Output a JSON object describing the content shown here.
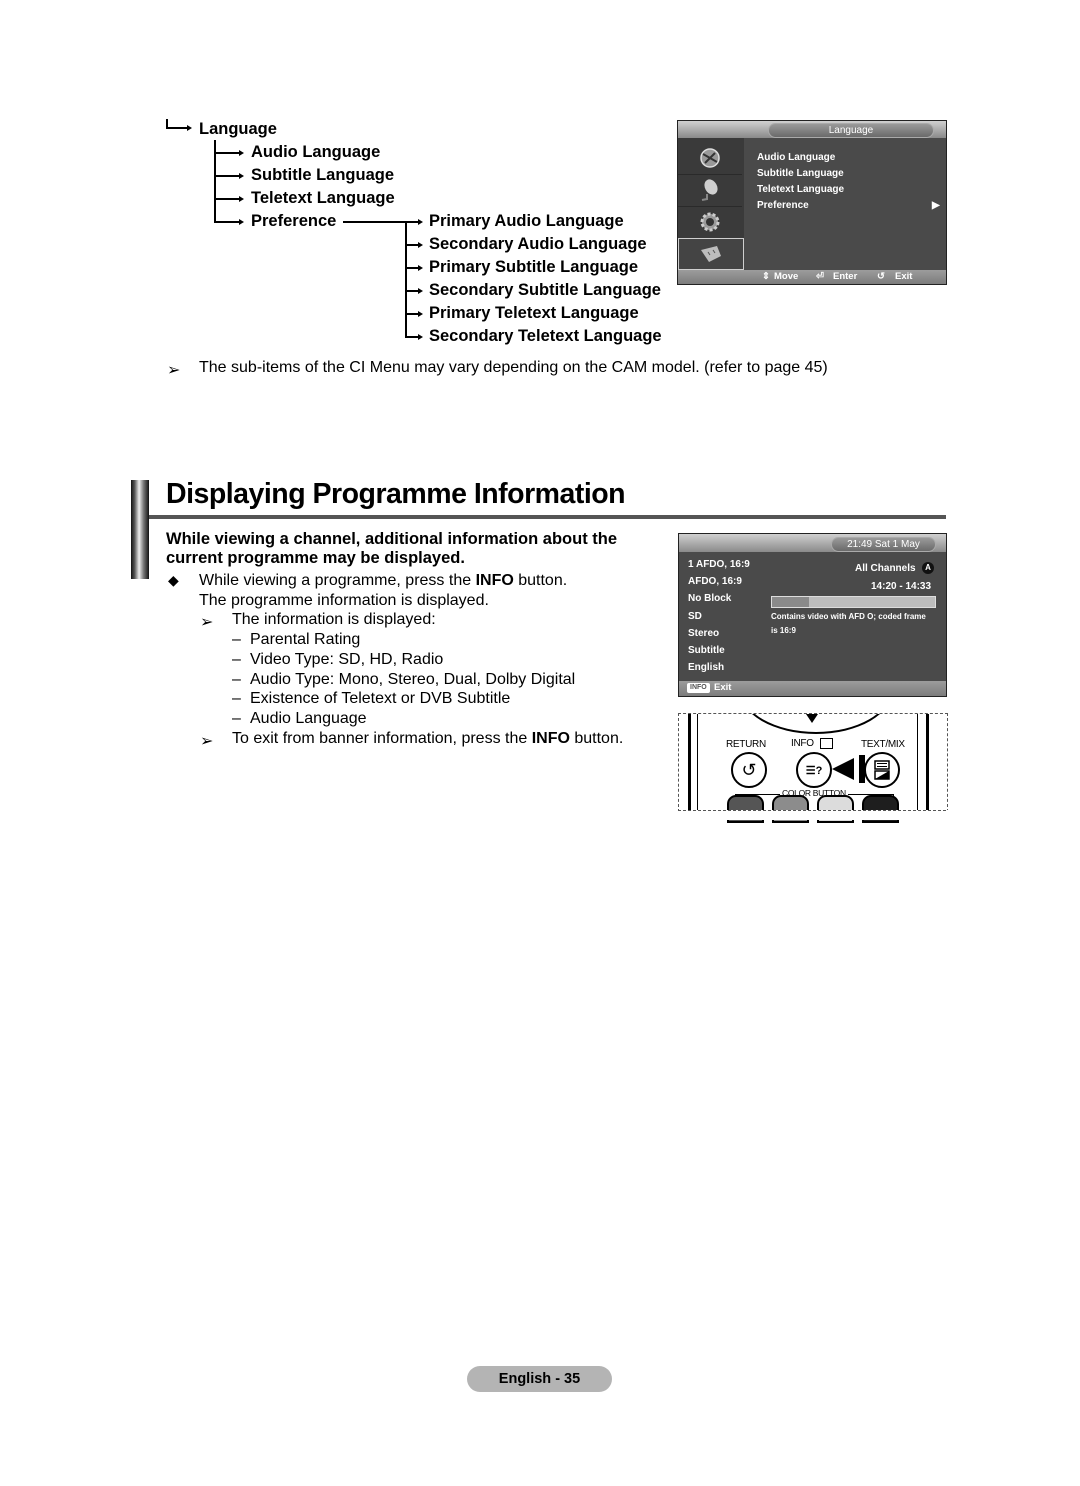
{
  "language_tree": {
    "root": "Language",
    "children": [
      "Audio Language",
      "Subtitle Language",
      "Teletext Language",
      "Preference"
    ],
    "preference_children": [
      "Primary Audio Language",
      "Secondary Audio Language",
      "Primary Subtitle Language",
      "Secondary Subtitle Language",
      "Primary Teletext Language",
      "Secondary Teletext Language"
    ]
  },
  "language_osd": {
    "title": "Language",
    "side_icons": [
      "picture-icon",
      "sound-icon",
      "setup-icon",
      "input-icon"
    ],
    "items": [
      "Audio Language",
      "Subtitle Language",
      "Teletext Language",
      "Preference"
    ],
    "submenu_arrow": "▶",
    "footer": {
      "move": "Move",
      "enter": "Enter",
      "exit": "Exit"
    }
  },
  "ci_note": "The sub-items of the CI Menu may vary depending on the CAM model. (refer to page 45)",
  "section": {
    "title": "Displaying Programme Information",
    "lead_line1": "While viewing a channel, additional information about the",
    "lead_line2": "current programme may be displayed.",
    "step_prefix": "While viewing a programme, press the ",
    "step_key": "INFO",
    "step_suffix": " button.",
    "step_line2": "The programme information is displayed.",
    "info_note": "The information is displayed:",
    "info_items": [
      "Parental Rating",
      "Video Type: SD, HD, Radio",
      "Audio Type: Mono, Stereo, Dual, Dolby Digital",
      "Existence of Teletext or DVB Subtitle",
      "Audio Language"
    ],
    "exit_prefix": "To exit from banner information, press the ",
    "exit_key": "INFO",
    "exit_suffix": " button."
  },
  "info_osd": {
    "datetime": "21:49 Sat 1 May",
    "left_lines": [
      "1 AFDO, 16:9",
      "AFDO, 16:9",
      "No Block",
      "SD",
      "Stereo",
      "Subtitle",
      "English"
    ],
    "channel_list": "All Channels",
    "channel_badge": "A",
    "time_range": "14:20 - 14:33",
    "progress_fraction": 0.23,
    "description_line1": "Contains video with AFD O; coded frame",
    "description_line2": "is 16:9",
    "footer_key": "INFO",
    "footer_exit": "Exit"
  },
  "remote": {
    "return_label": "RETURN",
    "info_label": "INFO",
    "textmix_label": "TEXT/MIX",
    "color_button_label": "COLOR BUTTON",
    "color_buttons": [
      "#555555",
      "#8c8c8c",
      "#dcdcdc",
      "#1e1e1e"
    ]
  },
  "footer": {
    "page_label": "English - 35"
  }
}
